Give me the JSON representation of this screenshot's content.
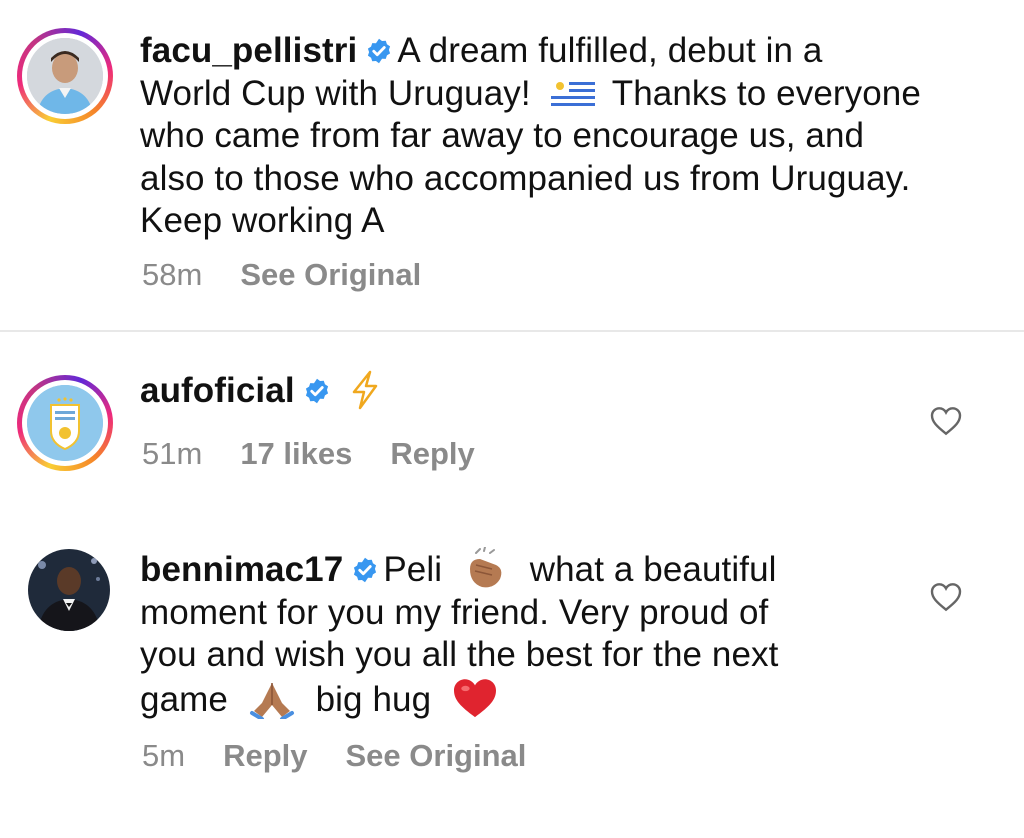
{
  "comments": [
    {
      "username": "facu_pellistri",
      "text_line1": "A dream fulfilled, debut in a",
      "text_line2a": "World Cup with Uruguay!",
      "text_line2b": "Thanks to everyone",
      "text_line3": "who came from far away to encourage us, and",
      "text_line4": "also to those who accompanied us from Uruguay.",
      "text_line5": "Keep working A",
      "time": "58m",
      "see_original": "See Original",
      "flag_icon": "uruguay-flag-icon"
    },
    {
      "username": "aufoficial",
      "time": "51m",
      "likes": "17 likes",
      "reply": "Reply",
      "emoji_icon": "lightning-icon"
    },
    {
      "username": "bennimac17",
      "text_line1a": "Peli",
      "text_line1b": "what a beautiful",
      "text_line2": "moment for you my friend. Very proud of",
      "text_line3": "you and wish you all the best for the next",
      "text_line4a": "game",
      "text_line4b": "big hug",
      "time": "5m",
      "reply": "Reply",
      "see_original": "See Original",
      "emoji_icons": [
        "clapping-hands-icon",
        "folded-hands-icon",
        "red-heart-icon"
      ]
    }
  ],
  "colors": {
    "verified": "#3897f0",
    "meta": "#8a8a8a",
    "divider": "#e8e8e8"
  }
}
